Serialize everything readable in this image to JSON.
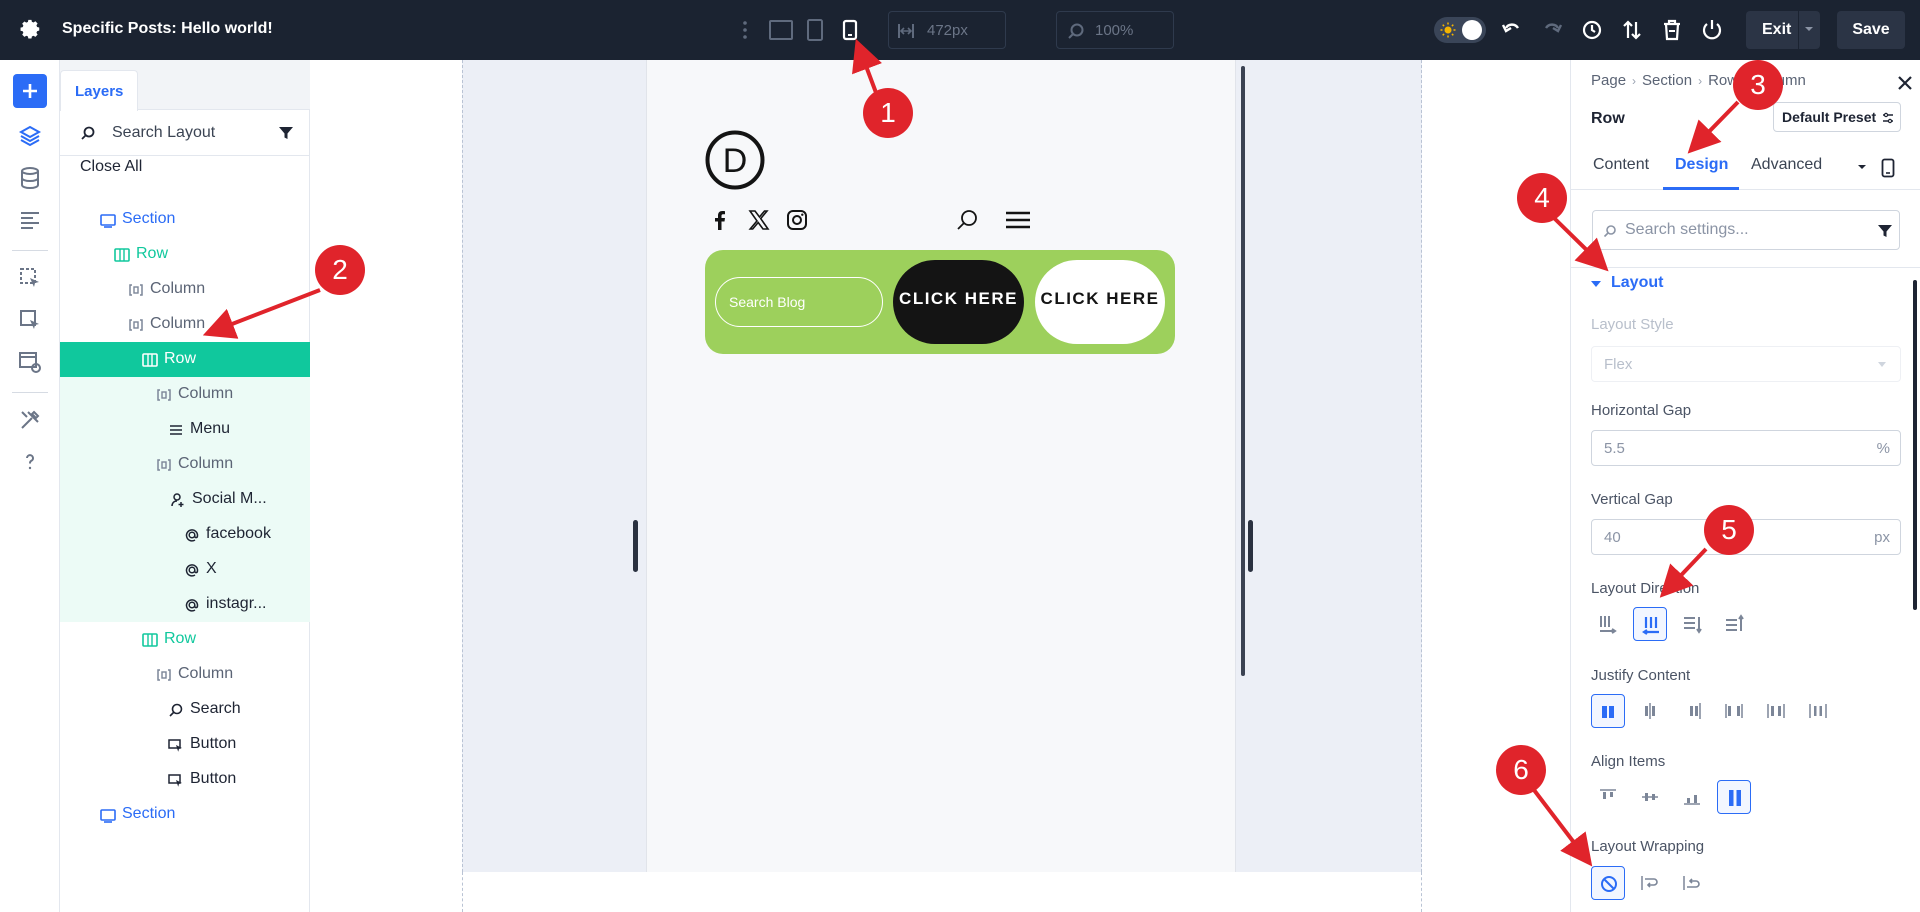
{
  "topbar": {
    "title": "Specific Posts: Hello world!",
    "width_value": "472px",
    "zoom_value": "100%",
    "exit_label": "Exit",
    "save_label": "Save"
  },
  "layers": {
    "tab_label": "Layers",
    "search_placeholder": "Search Layout",
    "close_all": "Close All",
    "items": [
      {
        "label": "Section",
        "icon": "section-icon"
      },
      {
        "label": "Row",
        "icon": "row-icon"
      },
      {
        "label": "Column",
        "icon": "column-icon"
      },
      {
        "label": "Column",
        "icon": "column-icon"
      },
      {
        "label": "Row",
        "icon": "row-icon"
      },
      {
        "label": "Column",
        "icon": "column-icon"
      },
      {
        "label": "Menu",
        "icon": "menu-icon"
      },
      {
        "label": "Column",
        "icon": "column-icon"
      },
      {
        "label": "Social M...",
        "icon": "social-icon"
      },
      {
        "label": "facebook",
        "icon": "at-icon"
      },
      {
        "label": "X",
        "icon": "at-icon"
      },
      {
        "label": "instagr...",
        "icon": "at-icon"
      },
      {
        "label": "Row",
        "icon": "row-icon"
      },
      {
        "label": "Column",
        "icon": "column-icon"
      },
      {
        "label": "Search",
        "icon": "search-icon"
      },
      {
        "label": "Button",
        "icon": "button-icon"
      },
      {
        "label": "Button",
        "icon": "button-icon"
      },
      {
        "label": "Section",
        "icon": "section-icon"
      }
    ]
  },
  "canvas": {
    "logo_letter": "D",
    "search_placeholder": "Search Blog",
    "button1_label": "CLICK HERE",
    "button2_label": "CLICK HERE",
    "row_color": "#9dd05c"
  },
  "settings": {
    "breadcrumb": [
      "Page",
      "Section",
      "Row",
      "Column"
    ],
    "element_title": "Row",
    "preset_label": "Default Preset",
    "tabs": [
      "Content",
      "Design",
      "Advanced"
    ],
    "active_tab": "Design",
    "search_placeholder": "Search settings...",
    "group_title": "Layout",
    "layout_style_label": "Layout Style",
    "layout_style_value": "Flex",
    "horizontal_gap_label": "Horizontal Gap",
    "horizontal_gap_value": "5.5",
    "horizontal_gap_unit": "%",
    "vertical_gap_label": "Vertical Gap",
    "vertical_gap_value": "40",
    "vertical_gap_unit": "px",
    "layout_direction_label": "Layout Direction",
    "justify_content_label": "Justify Content",
    "align_items_label": "Align Items",
    "layout_wrapping_label": "Layout Wrapping"
  },
  "annotations": [
    "1",
    "2",
    "3",
    "4",
    "5",
    "6"
  ],
  "colors": {
    "topbar": "#1b2331",
    "accent": "#2b6cf6",
    "selected_layer": "#10c89d",
    "annotation": "#e0242b"
  }
}
